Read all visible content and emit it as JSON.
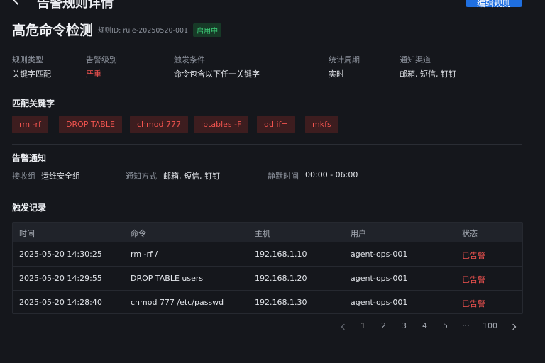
{
  "topbar": {
    "title": "告警规则详情",
    "action_label": "编辑规则"
  },
  "header": {
    "title": "高危命令检测",
    "rule_id": "规则ID: rule-20250520-001",
    "status": "启用中"
  },
  "info": [
    {
      "label": "规则类型",
      "value": "关键字匹配"
    },
    {
      "label": "告警级别",
      "value": "严重"
    },
    {
      "label": "触发条件",
      "value": "命令包含以下任一关键字"
    },
    {
      "label": "统计周期",
      "value": "实时"
    },
    {
      "label": "通知渠道",
      "value": "邮箱, 短信, 钉钉"
    }
  ],
  "keywords": {
    "title": "匹配关键字",
    "items": [
      "rm -rf",
      "DROP TABLE",
      "chmod 777",
      "iptables -F",
      "dd if=",
      "mkfs"
    ]
  },
  "notify": {
    "title": "告警通知",
    "receiver_label": "接收组",
    "receiver_value": "运维安全组",
    "method_label": "通知方式",
    "method_value": "邮箱, 短信, 钉钉",
    "silence_label": "静默时间",
    "silence_value": "00:00 - 06:00"
  },
  "records": {
    "title": "触发记录",
    "columns": [
      "时间",
      "命令",
      "主机",
      "用户",
      "状态"
    ],
    "rows": [
      [
        "2025-05-20 14:30:25",
        "rm -rf /",
        "192.168.1.10",
        "agent-ops-001",
        "已告警"
      ],
      [
        "2025-05-20 14:29:55",
        "DROP TABLE users",
        "192.168.1.20",
        "agent-ops-001",
        "已告警"
      ],
      [
        "2025-05-20 14:28:40",
        "chmod 777 /etc/passwd",
        "192.168.1.30",
        "agent-ops-001",
        "已告警"
      ]
    ]
  },
  "pagination": {
    "pages": [
      "1",
      "2",
      "3",
      "4",
      "5",
      "···",
      "100"
    ],
    "current": "1"
  },
  "colors": {
    "background": "#15171c",
    "primary": "#1f6fe0",
    "danger": "#f0524f",
    "success": "#3ccf78"
  }
}
